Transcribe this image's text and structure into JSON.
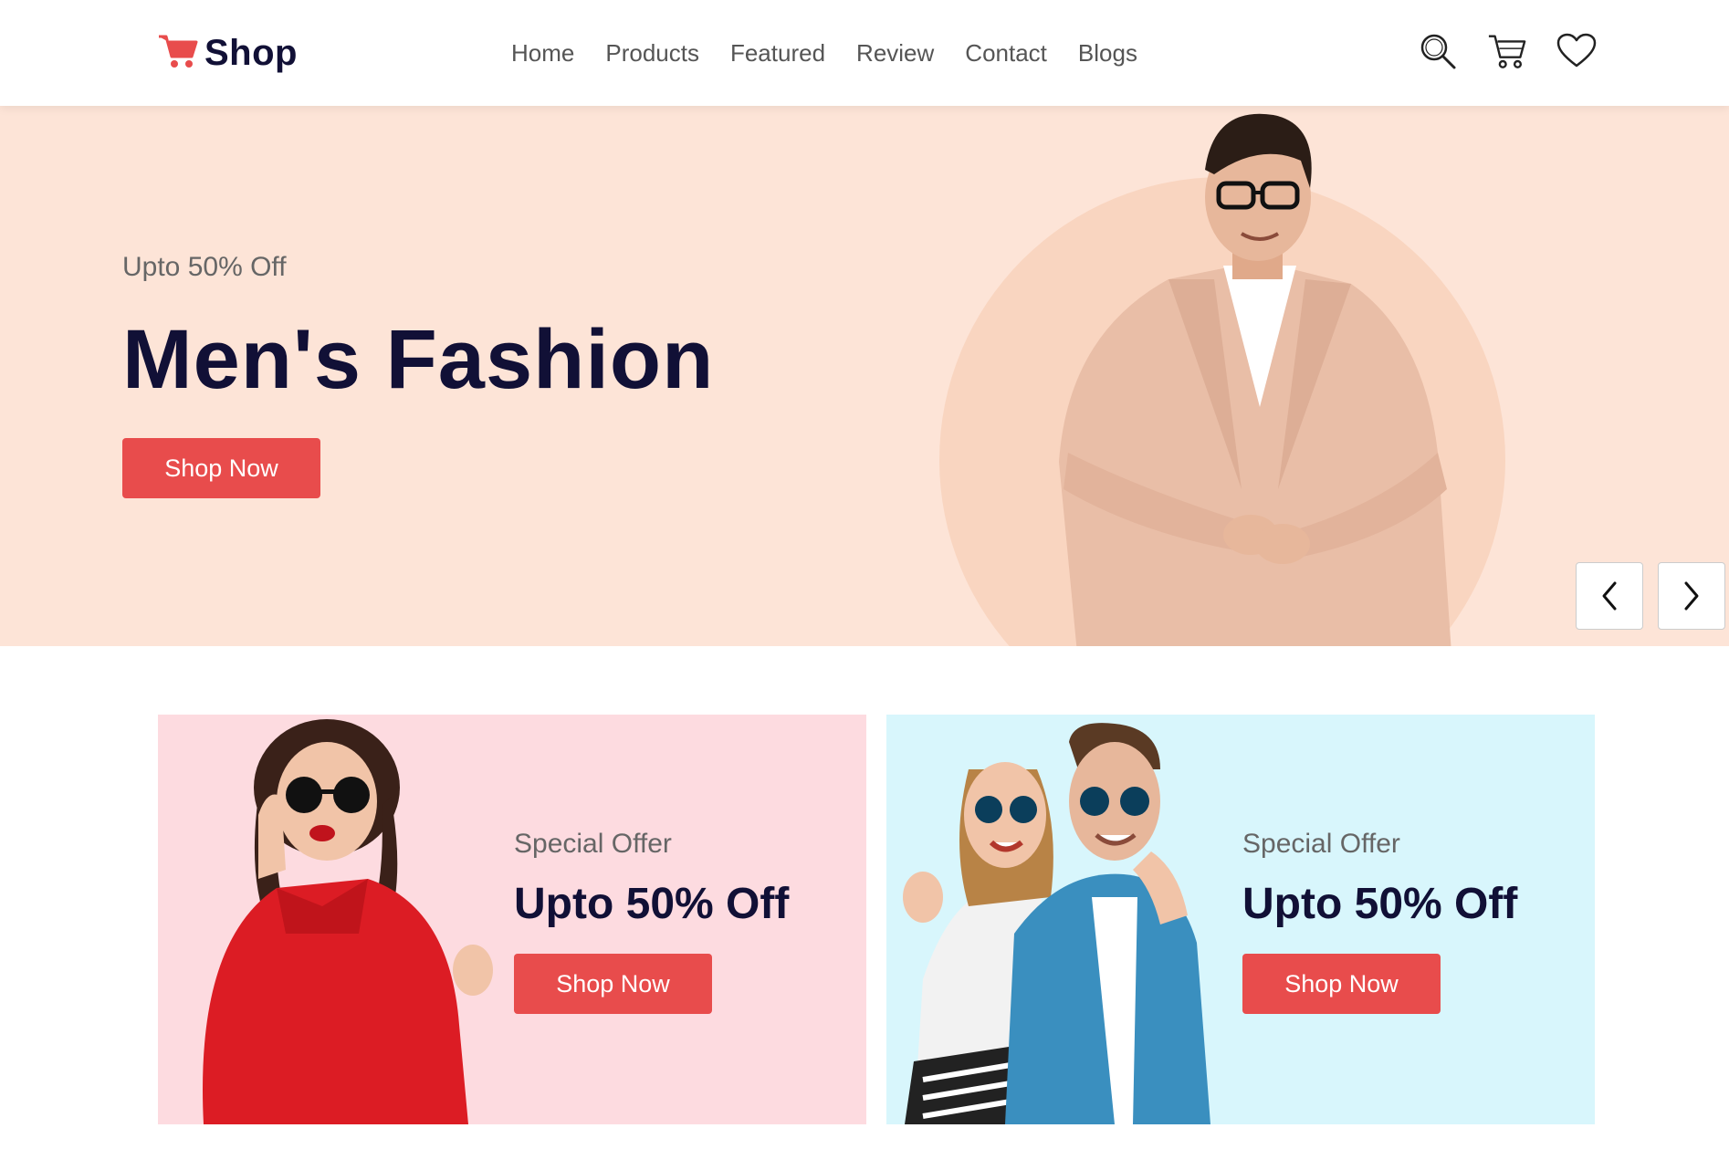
{
  "header": {
    "logo_text": "Shop",
    "nav": [
      "Home",
      "Products",
      "Featured",
      "Review",
      "Contact",
      "Blogs"
    ]
  },
  "hero": {
    "subtitle": "Upto 50% Off",
    "title": "Men's Fashion",
    "button": "Shop Now"
  },
  "offers": [
    {
      "subtitle": "Special Offer",
      "title": "Upto 50% Off",
      "button": "Shop Now"
    },
    {
      "subtitle": "Special Offer",
      "title": "Upto 50% Off",
      "button": "Shop Now"
    }
  ],
  "icons": {
    "logo": "cart-icon",
    "search": "search-icon",
    "cart": "cart-icon",
    "wishlist": "heart-icon",
    "prev": "chevron-left-icon",
    "next": "chevron-right-icon"
  },
  "colors": {
    "accent": "#e84c4c",
    "heading": "#111036",
    "hero_bg": "#fde4d7",
    "offer_pink_bg": "#fddbe0",
    "offer_cyan_bg": "#d8f6fc"
  }
}
